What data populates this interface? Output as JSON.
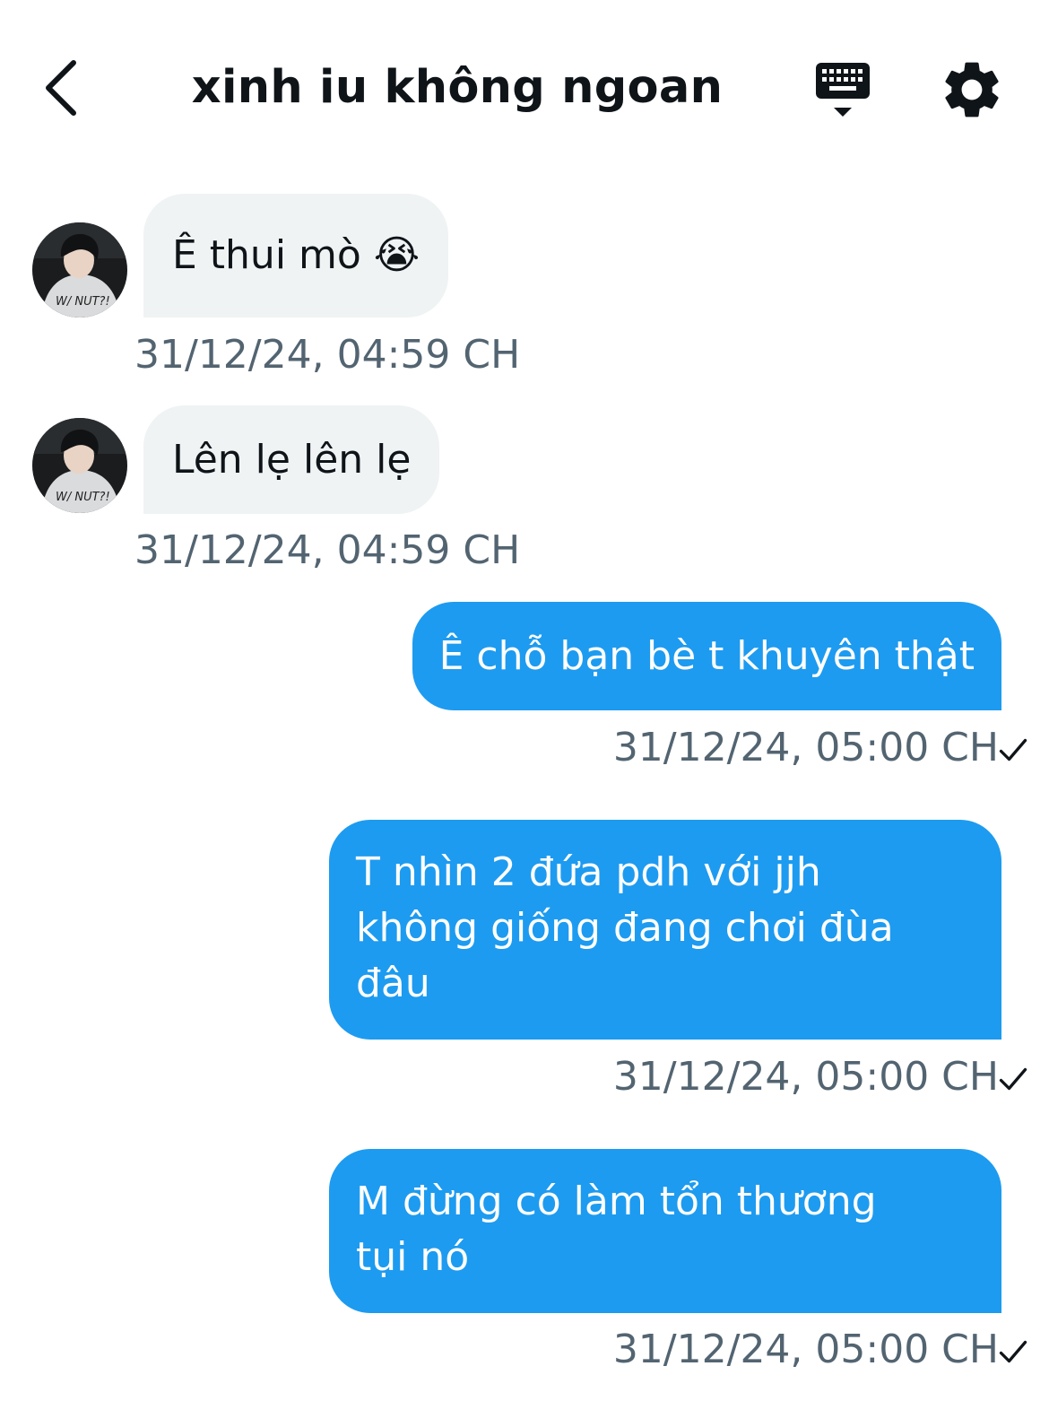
{
  "header": {
    "title": "xinh iu không ngoan",
    "back_icon": "chevron-left-icon",
    "keyboard_icon": "keyboard-icon",
    "settings_icon": "gear-icon"
  },
  "messages": [
    {
      "direction": "incoming",
      "text": "Ê thui mò 😭",
      "time": "31/12/24, 04:59 CH"
    },
    {
      "direction": "incoming",
      "text": "Lên lẹ lên lẹ",
      "time": "31/12/24, 04:59 CH"
    },
    {
      "direction": "outgoing",
      "text": "Ê chỗ bạn bè t khuyên thật",
      "time": "31/12/24, 05:00 CH",
      "status_icon": "check-icon"
    },
    {
      "direction": "outgoing",
      "lines": [
        "T nhìn 2 đứa pdh với jjh",
        "không giống đang chơi đùa",
        "đâu"
      ],
      "time": "31/12/24, 05:00 CH",
      "status_icon": "check-icon"
    },
    {
      "direction": "outgoing",
      "lines": [
        "M đừng có làm tổn thương",
        "tụi nó"
      ],
      "time": "31/12/24, 05:00 CH",
      "status_icon": "check-icon"
    }
  ],
  "colors": {
    "outgoing_bubble": "#1d9bf0",
    "incoming_bubble": "#eff3f4",
    "timestamp": "#536471",
    "text": "#0f1419"
  }
}
